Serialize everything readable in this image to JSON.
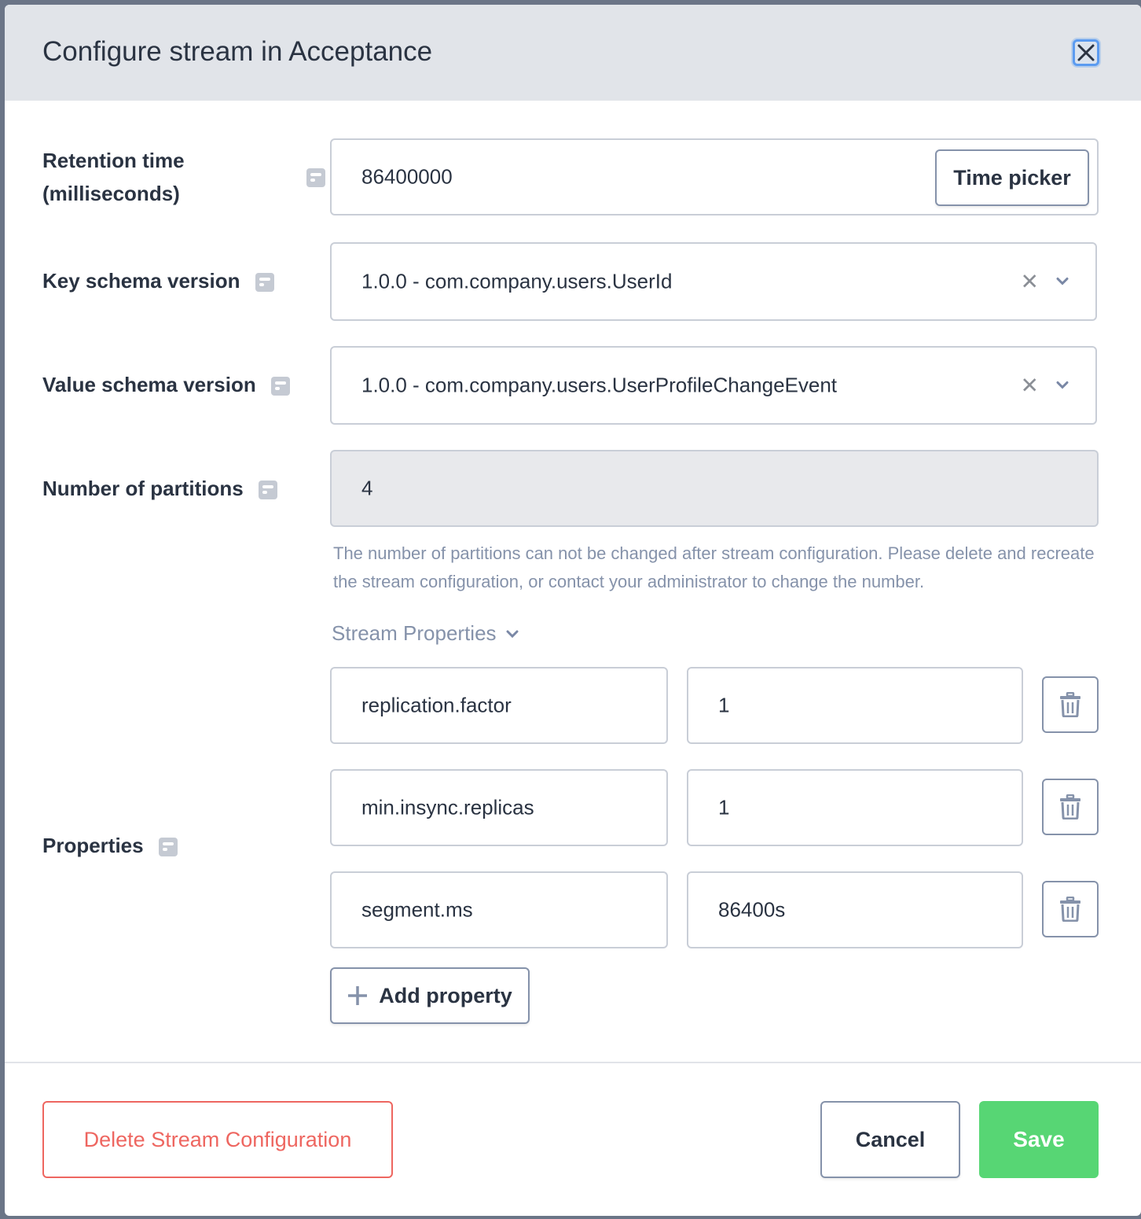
{
  "modal": {
    "title": "Configure stream in Acceptance",
    "close_icon": "close-icon"
  },
  "form": {
    "retention": {
      "label_line1": "Retention time",
      "label_line2": "(milliseconds)",
      "value": "86400000",
      "time_picker_label": "Time picker"
    },
    "key_schema": {
      "label": "Key schema version",
      "value": "1.0.0 - com.company.users.UserId"
    },
    "value_schema": {
      "label": "Value schema version",
      "value": "1.0.0 - com.company.users.UserProfileChangeEvent"
    },
    "partitions": {
      "label": "Number of partitions",
      "value": "4",
      "help": "The number of partitions can not be changed after stream configuration. Please delete and recreate the stream configuration, or contact your administrator to change the number."
    },
    "properties": {
      "label": "Properties",
      "section_title": "Stream Properties",
      "items": [
        {
          "key": "replication.factor",
          "value": "1"
        },
        {
          "key": "min.insync.replicas",
          "value": "1"
        },
        {
          "key": "segment.ms",
          "value": "86400s"
        }
      ],
      "add_label": "Add property"
    }
  },
  "footer": {
    "delete_label": "Delete Stream Configuration",
    "cancel_label": "Cancel",
    "save_label": "Save"
  },
  "colors": {
    "danger": "#ee6660",
    "success": "#57d674",
    "focus": "#5b9bf0",
    "muted": "#8592aa"
  }
}
